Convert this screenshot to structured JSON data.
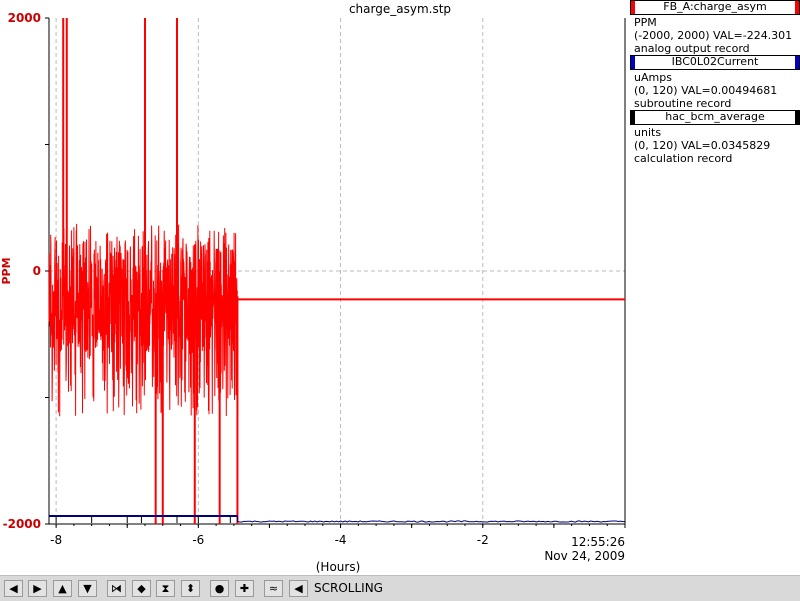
{
  "chart_data": {
    "type": "line",
    "title": "charge_asym.stp",
    "xlabel": "(Hours)",
    "ylabel": "PPM",
    "xlim": [
      -8.1,
      0
    ],
    "ylim": [
      -2000,
      2000
    ],
    "x_ticks": [
      "-8",
      "-6",
      "-4",
      "-2"
    ],
    "y_ticks": [
      "2000",
      "0",
      "-2000"
    ],
    "grid": true,
    "timestamp_time": "12:55:26",
    "timestamp_date": "Nov 24, 2009",
    "series": [
      {
        "name": "FB_A:charge_asym",
        "color": "#ff0000",
        "points_noisy_range": [
          -8.1,
          -5.45
        ],
        "noise_min": -1150,
        "noise_max": 380,
        "spikes_up": [
          {
            "x": -7.9,
            "y": 2000
          },
          {
            "x": -7.85,
            "y": 2000
          },
          {
            "x": -6.75,
            "y": 2000
          },
          {
            "x": -6.3,
            "y": 2000
          }
        ],
        "spikes_down": [
          {
            "x": -6.6,
            "y": -2000
          },
          {
            "x": -6.5,
            "y": -2000
          },
          {
            "x": -6.05,
            "y": -2000
          },
          {
            "x": -5.7,
            "y": -2000
          },
          {
            "x": -5.45,
            "y": -2000
          }
        ],
        "flat_value": -224.3,
        "flat_range": [
          -5.45,
          0
        ]
      },
      {
        "name": "IBC0L02Current",
        "color": "#000080",
        "value": 0.0049,
        "range": [
          0,
          120
        ]
      },
      {
        "name": "hac_bcm_average",
        "color": "#000000",
        "value": 0.0346,
        "range": [
          0,
          120
        ]
      }
    ]
  },
  "legend": {
    "items": [
      {
        "name": "FB_A:charge_asym",
        "color": "#ff0000",
        "units": "PPM",
        "range_value": "(-2000, 2000) VAL=-224.301",
        "record": "analog output record"
      },
      {
        "name": "IBC0L02Current",
        "color": "#0000cc",
        "units": "uAmps",
        "range_value": "(0, 120) VAL=0.00494681",
        "record": "subroutine record"
      },
      {
        "name": "hac_bcm_average",
        "color": "#000000",
        "units": "units",
        "range_value": "(0, 120) VAL=0.0345829",
        "record": "calculation record"
      }
    ]
  },
  "toolbar": {
    "status": "SCROLLING",
    "buttons": [
      {
        "name": "scroll-left-button",
        "icon": "arrow-left-icon",
        "glyph": "◀"
      },
      {
        "name": "scroll-right-button",
        "icon": "arrow-right-icon",
        "glyph": "▶"
      },
      {
        "name": "scroll-up-button",
        "icon": "arrow-up-icon",
        "glyph": "▲"
      },
      {
        "name": "scroll-down-button",
        "icon": "arrow-down-icon",
        "glyph": "▼"
      },
      {
        "name": "zoom-x-in-button",
        "icon": "zoom-x-in-icon",
        "glyph": "⧒"
      },
      {
        "name": "zoom-x-out-button",
        "icon": "zoom-x-out-icon",
        "glyph": "◆"
      },
      {
        "name": "zoom-y-in-button",
        "icon": "zoom-y-in-icon",
        "glyph": "⧗"
      },
      {
        "name": "zoom-y-out-button",
        "icon": "zoom-y-out-icon",
        "glyph": "⬍"
      },
      {
        "name": "autoscale-button",
        "icon": "circle-icon",
        "glyph": "●"
      },
      {
        "name": "add-button",
        "icon": "plus-icon",
        "glyph": "✚"
      },
      {
        "name": "style-button",
        "icon": "style-icon",
        "glyph": "≈"
      },
      {
        "name": "pan-button",
        "icon": "pan-left-icon",
        "glyph": "◀"
      }
    ]
  }
}
